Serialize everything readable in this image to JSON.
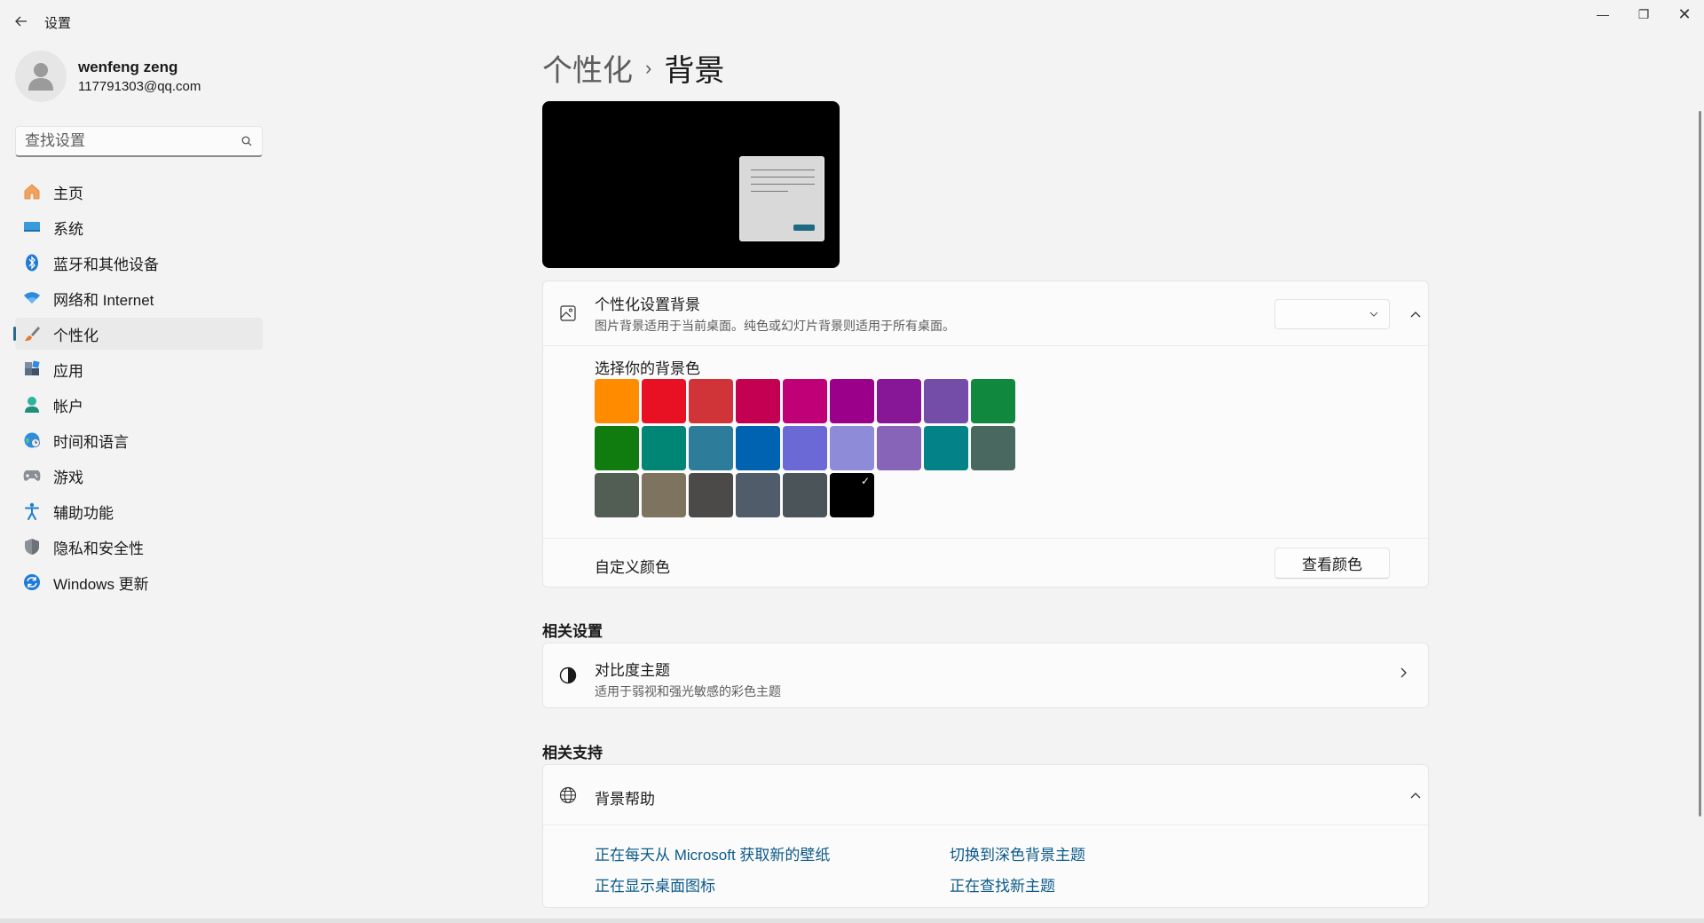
{
  "window": {
    "title": "设置",
    "back_icon": "arrow-left-icon",
    "controls": {
      "minimize": "—",
      "maximize": "❐",
      "close": "✕"
    }
  },
  "profile": {
    "name": "wenfeng zeng",
    "email": "117791303@qq.com"
  },
  "search": {
    "placeholder": "查找设置"
  },
  "sidebar": {
    "items": [
      {
        "label": "主页",
        "icon": "home-icon",
        "active": false
      },
      {
        "label": "系统",
        "icon": "display-icon",
        "active": false
      },
      {
        "label": "蓝牙和其他设备",
        "icon": "bluetooth-icon",
        "active": false
      },
      {
        "label": "网络和 Internet",
        "icon": "wifi-icon",
        "active": false
      },
      {
        "label": "个性化",
        "icon": "brush-icon",
        "active": true
      },
      {
        "label": "应用",
        "icon": "apps-icon",
        "active": false
      },
      {
        "label": "帐户",
        "icon": "account-icon",
        "active": false
      },
      {
        "label": "时间和语言",
        "icon": "globe-clock-icon",
        "active": false
      },
      {
        "label": "游戏",
        "icon": "gamepad-icon",
        "active": false
      },
      {
        "label": "辅助功能",
        "icon": "accessibility-icon",
        "active": false
      },
      {
        "label": "隐私和安全性",
        "icon": "shield-icon",
        "active": false
      },
      {
        "label": "Windows 更新",
        "icon": "update-icon",
        "active": false
      }
    ]
  },
  "breadcrumb": {
    "parent": "个性化",
    "separator": "›",
    "current": "背景"
  },
  "background_card": {
    "title": "个性化设置背景",
    "subtitle": "图片背景适用于当前桌面。纯色或幻灯片背景则适用于所有桌面。",
    "dropdown_value": "",
    "colors_title": "选择你的背景色",
    "colors": [
      "#ff8c00",
      "#e81123",
      "#d13438",
      "#c30052",
      "#bf0077",
      "#9a0089",
      "#881798",
      "#744da9",
      "#10893e",
      "#107c10",
      "#018574",
      "#2d7d9a",
      "#0063b1",
      "#6b69d6",
      "#8e8cd8",
      "#8764b8",
      "#038387",
      "#486860",
      "#525e54",
      "#7e735f",
      "#4c4a48",
      "#515c6b",
      "#4a5459",
      "#000000"
    ],
    "selected_color_index": 23,
    "custom_label": "自定义颜色",
    "view_button": "查看颜色"
  },
  "related_settings": {
    "title": "相关设置",
    "contrast_title": "对比度主题",
    "contrast_subtitle": "适用于弱视和强光敏感的彩色主题"
  },
  "related_support": {
    "title": "相关支持",
    "help_title": "背景帮助",
    "links": [
      "正在每天从 Microsoft 获取新的壁纸",
      "切换到深色背景主题",
      "正在显示桌面图标",
      "正在查找新主题"
    ]
  }
}
